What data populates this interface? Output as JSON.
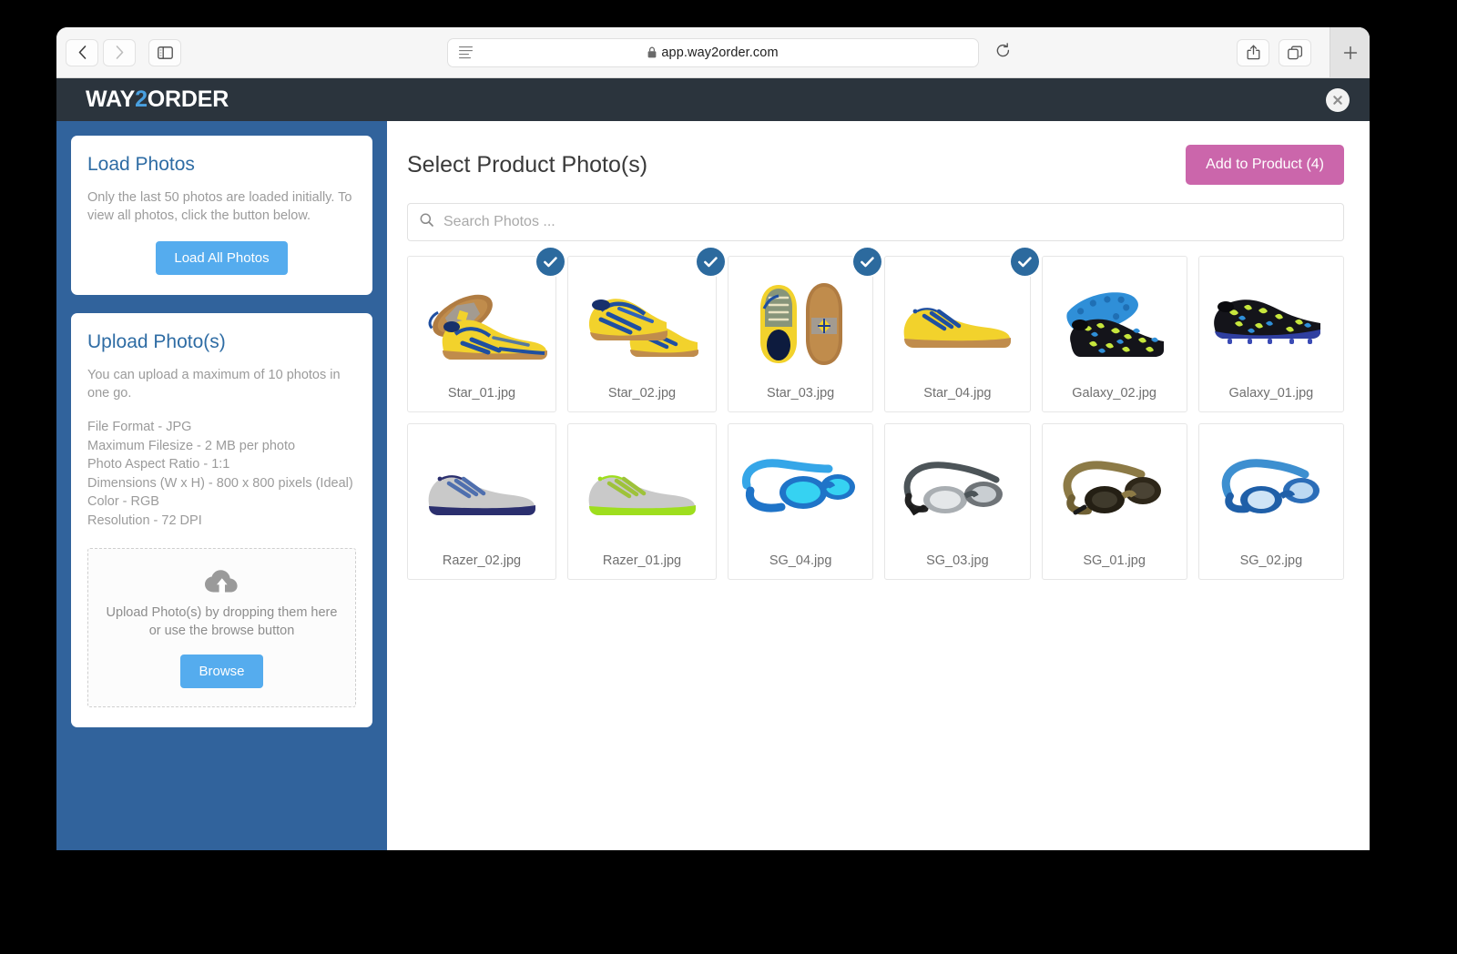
{
  "browser": {
    "back_icon": "chevron-left-icon",
    "forward_icon": "chevron-right-icon",
    "sidebar_toggle_icon": "sidebar-toggle-icon",
    "reader_icon": "reader-view-icon",
    "lock_icon": "lock-icon",
    "url": "app.way2order.com",
    "reload_icon": "reload-icon",
    "share_icon": "share-icon",
    "tabs_icon": "tab-overview-icon",
    "newtab_label": "+"
  },
  "app": {
    "logo_prefix": "WAY",
    "logo_accent": "2",
    "logo_suffix": "ORDER",
    "close_label": "✕",
    "accent_blue": "#31639c",
    "header_bg": "#2b343d",
    "pink": "#cb66ab",
    "button_blue": "#55acee"
  },
  "sidebar": {
    "load_photos": {
      "title": "Load Photos",
      "description": "Only the last 50 photos are loaded initially. To view all photos, click the button below.",
      "button_label": "Load All Photos"
    },
    "upload_photos": {
      "title": "Upload Photo(s)",
      "description": "You can upload a maximum of 10 photos in one go.",
      "specs": [
        "File Format - JPG",
        "Maximum Filesize - 2 MB per photo",
        "Photo Aspect Ratio - 1:1",
        "Dimensions (W x H) - 800 x 800 pixels (Ideal)",
        "Color - RGB",
        "Resolution - 72 DPI"
      ],
      "dropzone": {
        "icon": "cloud-upload-icon",
        "text": "Upload Photo(s) by dropping them here or use the browse button",
        "button_label": "Browse"
      }
    }
  },
  "main": {
    "title": "Select Product Photo(s)",
    "add_button_label": "Add to Product (4)",
    "search": {
      "icon": "search-icon",
      "placeholder": "Search Photos ...",
      "value": ""
    },
    "photos": [
      {
        "name": "Star_01.jpg",
        "selected": true,
        "art": "shoe-pair-yellow"
      },
      {
        "name": "Star_02.jpg",
        "selected": true,
        "art": "shoe-pair-yellow-angle"
      },
      {
        "name": "Star_03.jpg",
        "selected": true,
        "art": "shoe-top-sole-yellow"
      },
      {
        "name": "Star_04.jpg",
        "selected": true,
        "art": "shoe-side-yellow"
      },
      {
        "name": "Galaxy_02.jpg",
        "selected": false,
        "art": "cleat-pair-black"
      },
      {
        "name": "Galaxy_01.jpg",
        "selected": false,
        "art": "cleat-side-black"
      },
      {
        "name": "Razer_02.jpg",
        "selected": false,
        "art": "shoe-side-grey-navy"
      },
      {
        "name": "Razer_01.jpg",
        "selected": false,
        "art": "shoe-side-grey-lime"
      },
      {
        "name": "SG_04.jpg",
        "selected": false,
        "art": "goggles-bright-blue"
      },
      {
        "name": "SG_03.jpg",
        "selected": false,
        "art": "goggles-grey"
      },
      {
        "name": "SG_01.jpg",
        "selected": false,
        "art": "goggles-olive"
      },
      {
        "name": "SG_02.jpg",
        "selected": false,
        "art": "goggles-blue"
      }
    ]
  }
}
